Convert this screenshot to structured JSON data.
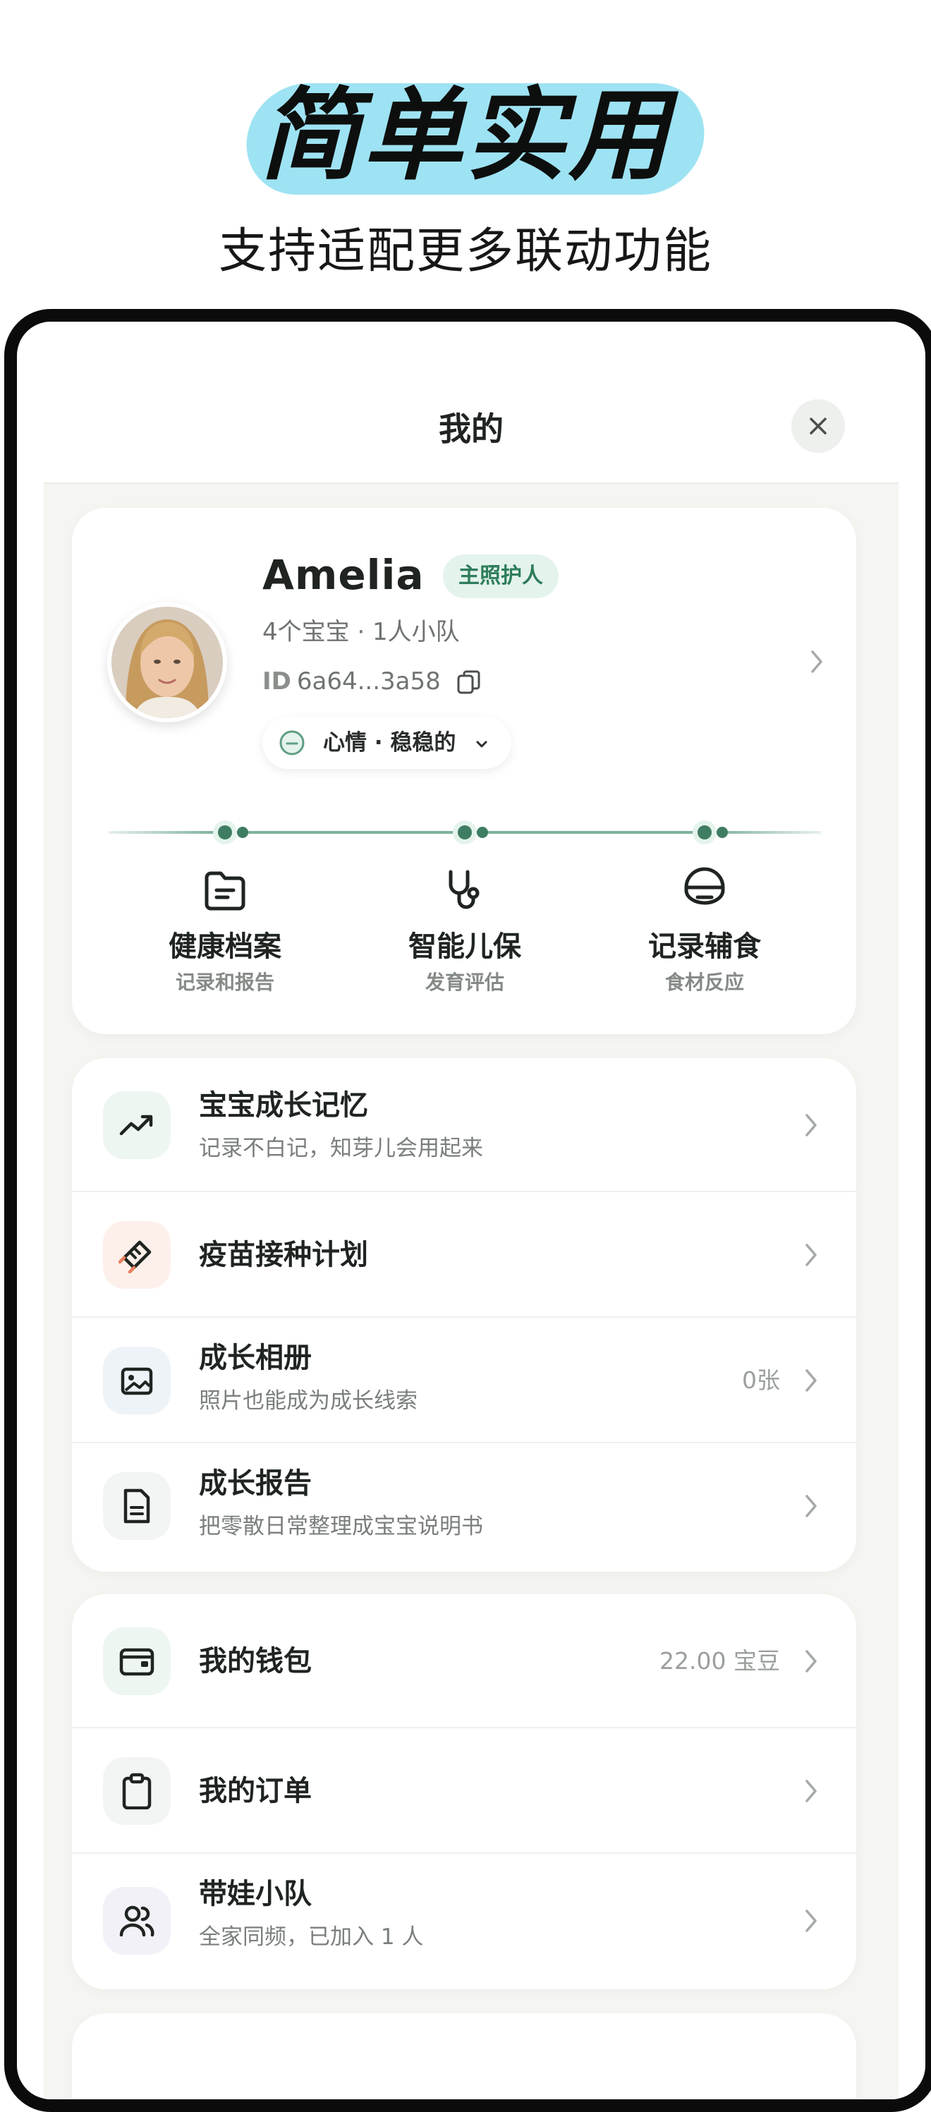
{
  "hero": {
    "title": "简单实用",
    "subtitle": "支持适配更多联动功能"
  },
  "topbar": {
    "title": "我的",
    "close_icon": "close-icon"
  },
  "profile": {
    "name": "Amelia",
    "role": "主照护人",
    "meta": "4个宝宝 · 1人小队",
    "id_label": "ID",
    "id_value": "6a64...3a58",
    "mood": "心情 · 稳稳的"
  },
  "features": [
    {
      "title": "健康档案",
      "subtitle": "记录和报告",
      "icon": "folder-icon"
    },
    {
      "title": "智能儿保",
      "subtitle": "发育评估",
      "icon": "stethoscope-icon"
    },
    {
      "title": "记录辅食",
      "subtitle": "食材反应",
      "icon": "bowl-icon"
    }
  ],
  "records": [
    {
      "title": "宝宝成长记忆",
      "subtitle": "记录不白记，知芽儿会用起来",
      "value": "",
      "icon": "trend-up-icon"
    },
    {
      "title": "疫苗接种计划",
      "subtitle": "",
      "value": "",
      "icon": "syringe-icon"
    },
    {
      "title": "成长相册",
      "subtitle": "照片也能成为成长线索",
      "value": "0张",
      "icon": "photo-album-icon"
    },
    {
      "title": "成长报告",
      "subtitle": "把零散日常整理成宝宝说明书",
      "value": "",
      "icon": "report-document-icon"
    }
  ],
  "account": [
    {
      "title": "我的钱包",
      "subtitle": "",
      "value": "22.00 宝豆",
      "icon": "wallet-icon"
    },
    {
      "title": "我的订单",
      "subtitle": "",
      "value": "",
      "icon": "clipboard-icon"
    },
    {
      "title": "带娃小队",
      "subtitle": "全家同频，已加入 1 人",
      "value": "",
      "icon": "team-users-icon"
    }
  ],
  "colors": {
    "hero_highlight": "#9ee3f3",
    "accent_green": "#2e7d5b",
    "badge_bg": "#e4f3ec",
    "screen_bg": "#f5f5f2"
  }
}
